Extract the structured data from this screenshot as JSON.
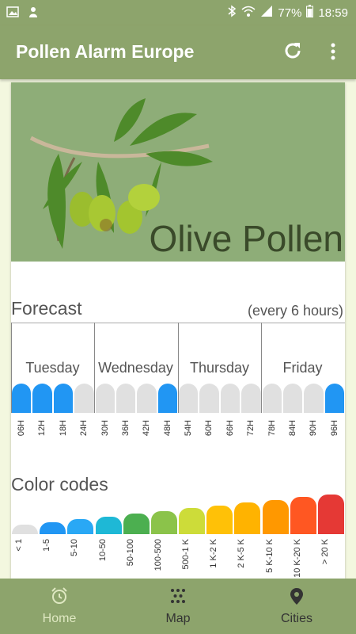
{
  "status": {
    "battery": "77%",
    "time": "18:59"
  },
  "appbar": {
    "title": "Pollen Alarm Europe"
  },
  "hero": {
    "name": "Olive Pollen",
    "bg_color": "#8ead78"
  },
  "forecast": {
    "title": "Forecast",
    "note": "(every 6 hours)",
    "days": [
      "Tuesday",
      "Wednesday",
      "Thursday",
      "Friday"
    ],
    "hours": [
      "06H",
      "12H",
      "18H",
      "24H",
      "30H",
      "36H",
      "42H",
      "48H",
      "54H",
      "60H",
      "66H",
      "72H",
      "78H",
      "84H",
      "90H",
      "96H"
    ],
    "active_color": "#2196f3",
    "inactive_color": "#e0e0e0",
    "active_slots": [
      true,
      true,
      true,
      false,
      false,
      false,
      false,
      true,
      false,
      false,
      false,
      false,
      false,
      false,
      false,
      true
    ]
  },
  "color_codes": {
    "title": "Color codes",
    "labels": [
      "< 1",
      "1-5",
      "5-10",
      "10-50",
      "50-100",
      "100-500",
      "500-1 K",
      "1 K-2 K",
      "2 K-5 K",
      "5 K-10 K",
      "10 K-20 K",
      "> 20 K"
    ],
    "colors": [
      "#e0e0e0",
      "#2196f3",
      "#29a8f5",
      "#1eb8d6",
      "#4caf50",
      "#8bc34a",
      "#cddc39",
      "#ffc107",
      "#ffb300",
      "#ff9800",
      "#ff5722",
      "#e53935"
    ]
  },
  "nav": {
    "items": [
      "Home",
      "Map",
      "Cities"
    ],
    "active_label_color": "#dfe8c2"
  }
}
